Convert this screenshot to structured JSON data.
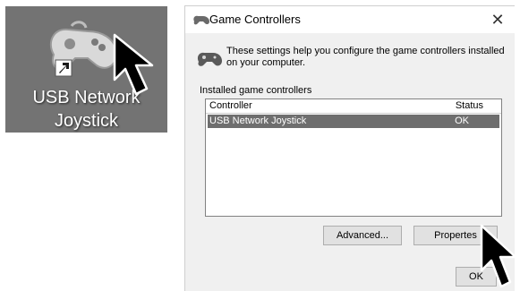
{
  "desktop": {
    "shortcut": {
      "label_line1": "USB Network",
      "label_line2": "Joystick",
      "icon": "gamepad-icon",
      "overlay_icon": "shortcut-arrow-icon"
    },
    "background": "#737373"
  },
  "dialog": {
    "title": "Game Controllers",
    "title_icon": "gamepad-icon",
    "close_label": "✕",
    "intro_text": "These settings help you configure the game controllers installed on your computer.",
    "intro_icon": "gamepad-icon",
    "group_label": "Installed game controllers",
    "columns": {
      "controller": "Controller",
      "status": "Status"
    },
    "rows": [
      {
        "name": "USB Network Joystick",
        "status": "OK",
        "selected": true
      }
    ],
    "buttons": {
      "advanced": "Advanced...",
      "properties": "Propertes",
      "ok": "OK"
    }
  },
  "colors": {
    "selection": "#6e6e6e",
    "dialog_bg": "#f0f0f0"
  }
}
